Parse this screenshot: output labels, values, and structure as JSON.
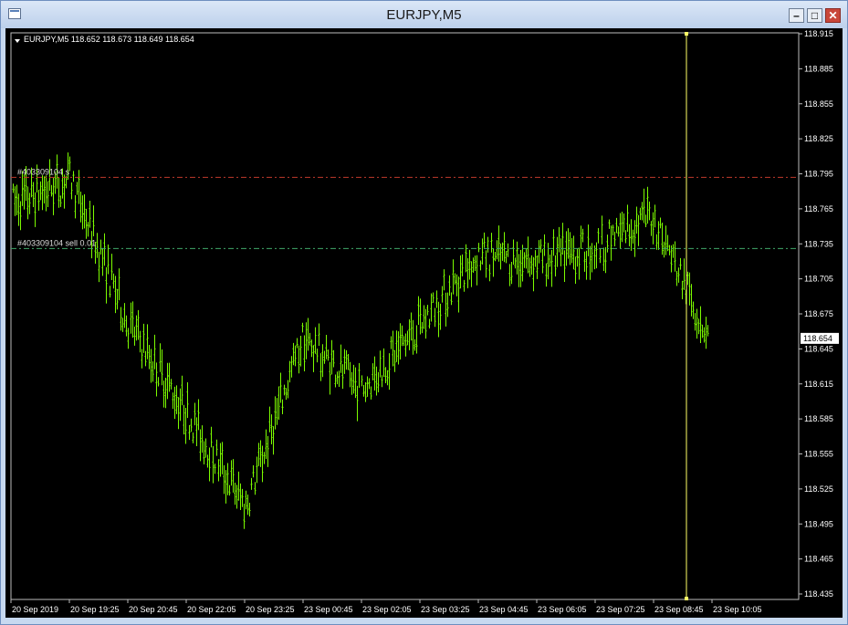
{
  "window": {
    "title": "EURJPY,M5",
    "icon": "chart-window-icon",
    "buttons": {
      "minimize": "–",
      "maximize": "□",
      "close": "✕"
    }
  },
  "chart": {
    "header": "EURJPY,M5  118.652 118.673 118.649 118.654",
    "dropdown_icon": "triangle-down-icon",
    "current_price": "118.654",
    "order_lines": [
      {
        "label": "#403309104 s",
        "price": 118.792,
        "color": "#c0392b"
      },
      {
        "label": "#403309104 sell 0.01",
        "price": 118.731,
        "color": "#3fa86a"
      }
    ],
    "time_labels": [
      "20 Sep 2019",
      "20 Sep 19:25",
      "20 Sep 20:45",
      "20 Sep 22:05",
      "20 Sep 23:25",
      "23 Sep 00:45",
      "23 Sep 02:05",
      "23 Sep 03:25",
      "23 Sep 04:45",
      "23 Sep 06:05",
      "23 Sep 07:25",
      "23 Sep 08:45",
      "23 Sep 10:05"
    ],
    "colors": {
      "background": "#000000",
      "candles": "#7CFC00",
      "text": "#ffffff",
      "vline": "#ffff66"
    }
  },
  "chart_data": {
    "type": "line",
    "title": "EURJPY,M5",
    "x": [
      "20 Sep 2019",
      "20 Sep 19:25",
      "20 Sep 20:45",
      "20 Sep 22:05",
      "20 Sep 23:25",
      "23 Sep 00:45",
      "23 Sep 02:05",
      "23 Sep 03:25",
      "23 Sep 04:45",
      "23 Sep 06:05",
      "23 Sep 07:25",
      "23 Sep 08:45",
      "23 Sep 10:05"
    ],
    "series": [
      {
        "values": [
          118.77,
          118.79,
          118.665,
          118.59,
          118.51,
          118.655,
          118.61,
          118.665,
          118.725,
          118.72,
          118.73,
          118.76,
          118.654
        ]
      }
    ],
    "ylim": [
      118.435,
      118.915
    ],
    "y_ticks": [
      118.915,
      118.885,
      118.855,
      118.825,
      118.795,
      118.765,
      118.735,
      118.705,
      118.675,
      118.645,
      118.615,
      118.585,
      118.555,
      118.525,
      118.495,
      118.465,
      118.435
    ]
  }
}
